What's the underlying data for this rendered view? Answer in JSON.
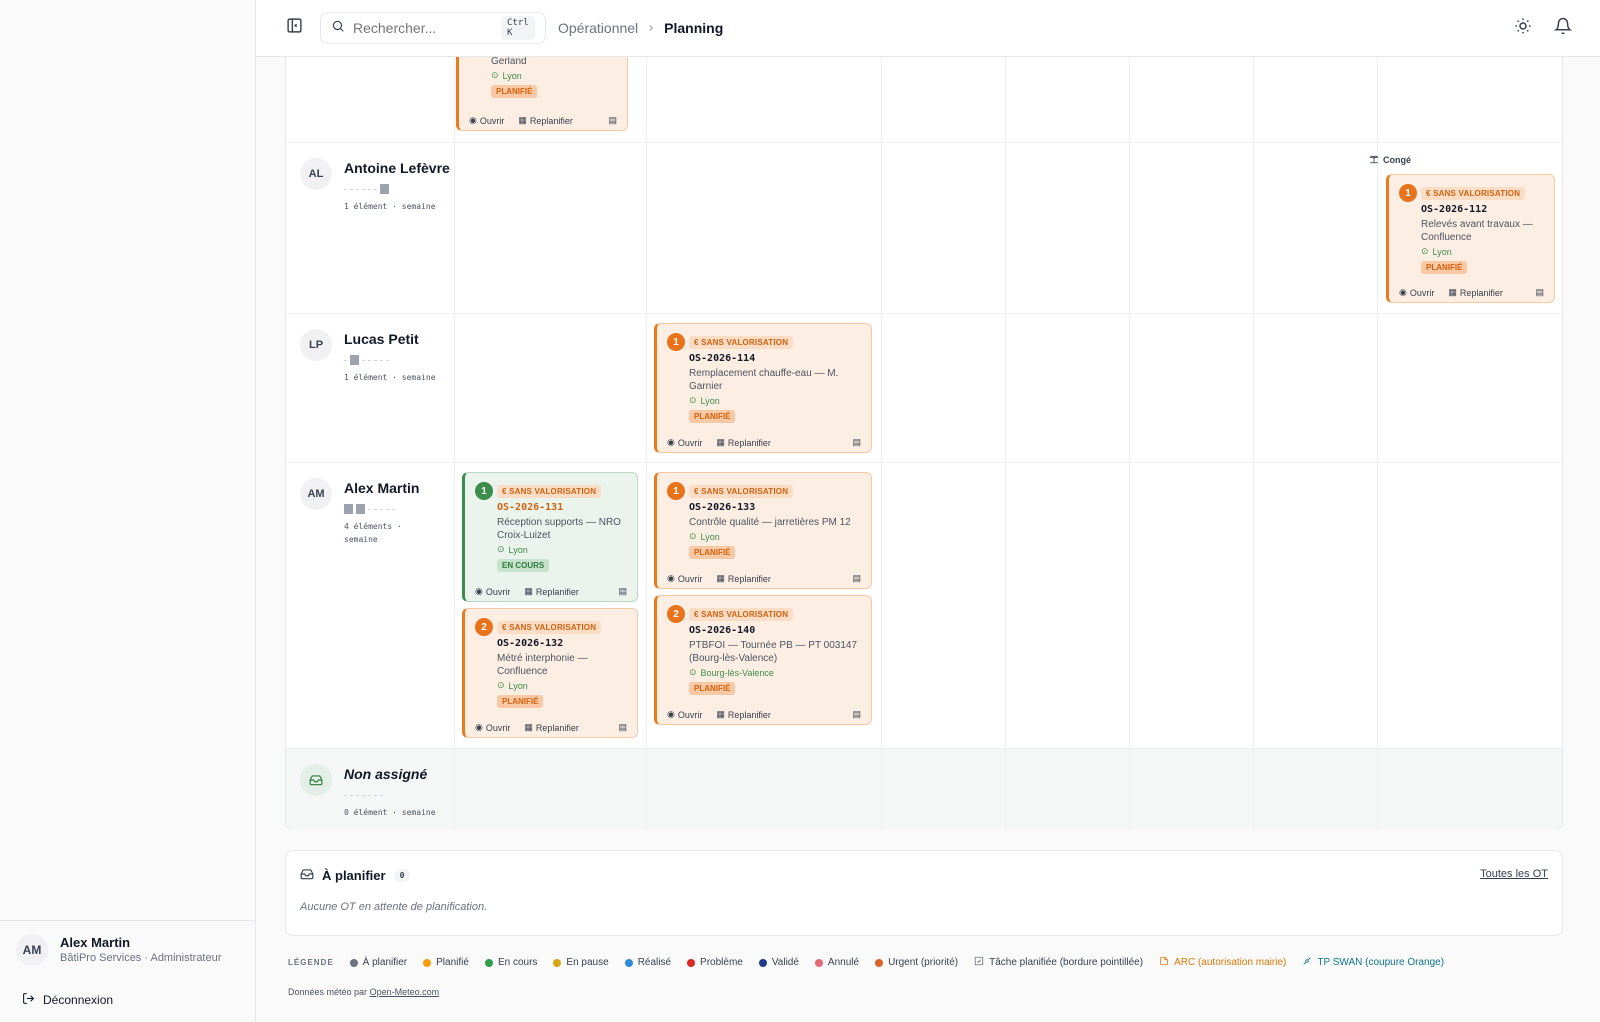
{
  "header": {
    "search_placeholder": "Rechercher...",
    "shortcut": "Ctrl K",
    "breadcrumb_parent": "Opérationnel",
    "breadcrumb_current": "Planning"
  },
  "sidebar": {
    "user_initials": "AM",
    "user_name": "Alex Martin",
    "user_role": "BâtiPro Services · Administrateur",
    "logout_label": "Déconnexion"
  },
  "technicians": [
    {
      "initials": "AL",
      "name": "Antoine Lefèvre",
      "count": "1 élément · semaine"
    },
    {
      "initials": "LP",
      "name": "Lucas Petit",
      "count": "1 élément · semaine"
    },
    {
      "initials": "AM",
      "name": "Alex Martin",
      "count_1": "4 éléments ·",
      "count_2": "semaine"
    },
    {
      "name": "Non assigné",
      "count": "0 élément · semaine"
    }
  ],
  "conge_label": "Congé",
  "action_labels": {
    "open": "Ouvrir",
    "reschedule": "Replanifier"
  },
  "valorisation_label": "€ SANS VALORISATION",
  "cards": {
    "top_partial": {
      "desc": "Gerland",
      "loc": "Lyon",
      "status": "PLANIFIÉ"
    },
    "c112": {
      "num": "1",
      "code": "OS-2026-112",
      "desc_1": "Relevés avant travaux —",
      "desc_2": "Confluence",
      "loc": "Lyon",
      "status": "PLANIFIÉ"
    },
    "c114": {
      "num": "1",
      "code": "OS-2026-114",
      "desc_1": "Remplacement chauffe-eau — M.",
      "desc_2": "Garnier",
      "loc": "Lyon",
      "status": "PLANIFIÉ"
    },
    "c131": {
      "num": "1",
      "code": "OS-2026-131",
      "desc_1": "Réception supports — NRO",
      "desc_2": "Croix-Luizet",
      "loc": "Lyon",
      "status": "EN COURS"
    },
    "c133": {
      "num": "1",
      "code": "OS-2026-133",
      "desc_1": "Contrôle qualité — jarretières PM 12",
      "loc": "Lyon",
      "status": "PLANIFIÉ"
    },
    "c132": {
      "num": "2",
      "code": "OS-2026-132",
      "desc_1": "Métré interphonie —",
      "desc_2": "Confluence",
      "loc": "Lyon",
      "status": "PLANIFIÉ"
    },
    "c140": {
      "num": "2",
      "code": "OS-2026-140",
      "desc_1": "PTBFOI — Tournée PB — PT 003147",
      "desc_2": "(Bourg-lès-Valence)",
      "loc": "Bourg-lès-Valence",
      "status": "PLANIFIÉ"
    }
  },
  "a_planifier": {
    "title": "À planifier",
    "count": "0",
    "link": "Toutes les OT",
    "empty": "Aucune OT en attente de planification."
  },
  "legend": {
    "title": "LÉGENDE",
    "items": [
      {
        "label": "À planifier",
        "color": "#6b7280"
      },
      {
        "label": "Planifié",
        "color": "#f59e0b"
      },
      {
        "label": "En cours",
        "color": "#2f9e4a"
      },
      {
        "label": "En pause",
        "color": "#d4a514"
      },
      {
        "label": "Réalisé",
        "color": "#2b8bd6"
      },
      {
        "label": "Problème",
        "color": "#dc2626"
      },
      {
        "label": "Validé",
        "color": "#1e3a8a"
      },
      {
        "label": "Annulé",
        "color": "#e26a78"
      },
      {
        "label": "Urgent (priorité)",
        "color": "#d9622b"
      }
    ],
    "task_label": "Tâche planifiée (bordure pointillée)",
    "arc_label": "ARC (autorisation mairie)",
    "tp_label": "TP SWAN (coupure Orange)",
    "arc_color": "#d97706",
    "tp_color": "#0e7490"
  },
  "footer": {
    "prefix": "Données météo par",
    "link": "Open-Meteo.com"
  }
}
